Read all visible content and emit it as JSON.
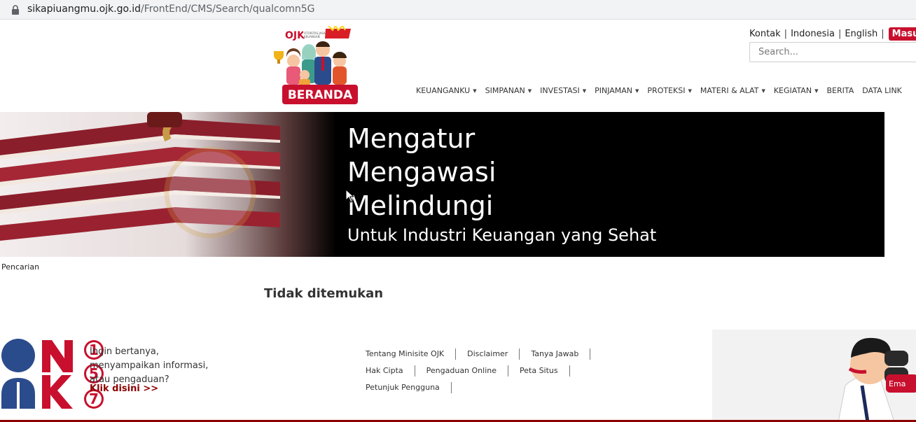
{
  "browser": {
    "url_domain": "sikapiuangmu.ojk.go.id",
    "url_path": "/FrontEnd/CMS/Search/qualcomn5G"
  },
  "logo": {
    "badge_text": "BERANDA",
    "brand_text": "OJK"
  },
  "topnav": {
    "items": [
      "Kontak",
      "Indonesia",
      "English"
    ],
    "login_label": "Masuk"
  },
  "search": {
    "placeholder": "Search..."
  },
  "mainnav": {
    "items": [
      {
        "label": "KEUANGANKU",
        "dropdown": true
      },
      {
        "label": "SIMPANAN",
        "dropdown": true
      },
      {
        "label": "INVESTASI",
        "dropdown": true
      },
      {
        "label": "PINJAMAN",
        "dropdown": true
      },
      {
        "label": "PROTEKSI",
        "dropdown": true
      },
      {
        "label": "MATERI & ALAT",
        "dropdown": true
      },
      {
        "label": "KEGIATAN",
        "dropdown": true
      },
      {
        "label": "BERITA",
        "dropdown": false
      },
      {
        "label": "DATA LINK",
        "dropdown": false
      }
    ]
  },
  "banner": {
    "line1": "Mengatur",
    "line2": "Mengawasi",
    "line3": "Melindungi",
    "line4": "Untuk Industri Keuangan yang Sehat"
  },
  "breadcrumb": "Pencarian",
  "result": {
    "message": "Tidak ditemukan"
  },
  "footer": {
    "hotline_digits": [
      "1",
      "5",
      "7"
    ],
    "help_text": "Ingin bertanya, menyampaikan informasi, atau pengaduan?",
    "help_link": "Klik disini >>",
    "links_row1": [
      "Tentang Minisite OJK",
      "Disclaimer",
      "Tanya Jawab"
    ],
    "links_row2": [
      "Hak Cipta",
      "Pengaduan Online",
      "Peta Situs"
    ],
    "links_row3": [
      "Petunjuk Pengguna"
    ],
    "email_badge": "Ema"
  },
  "colors": {
    "brand_red": "#c8102e",
    "dark_red": "#8b0000",
    "navy": "#2b4c8c"
  }
}
